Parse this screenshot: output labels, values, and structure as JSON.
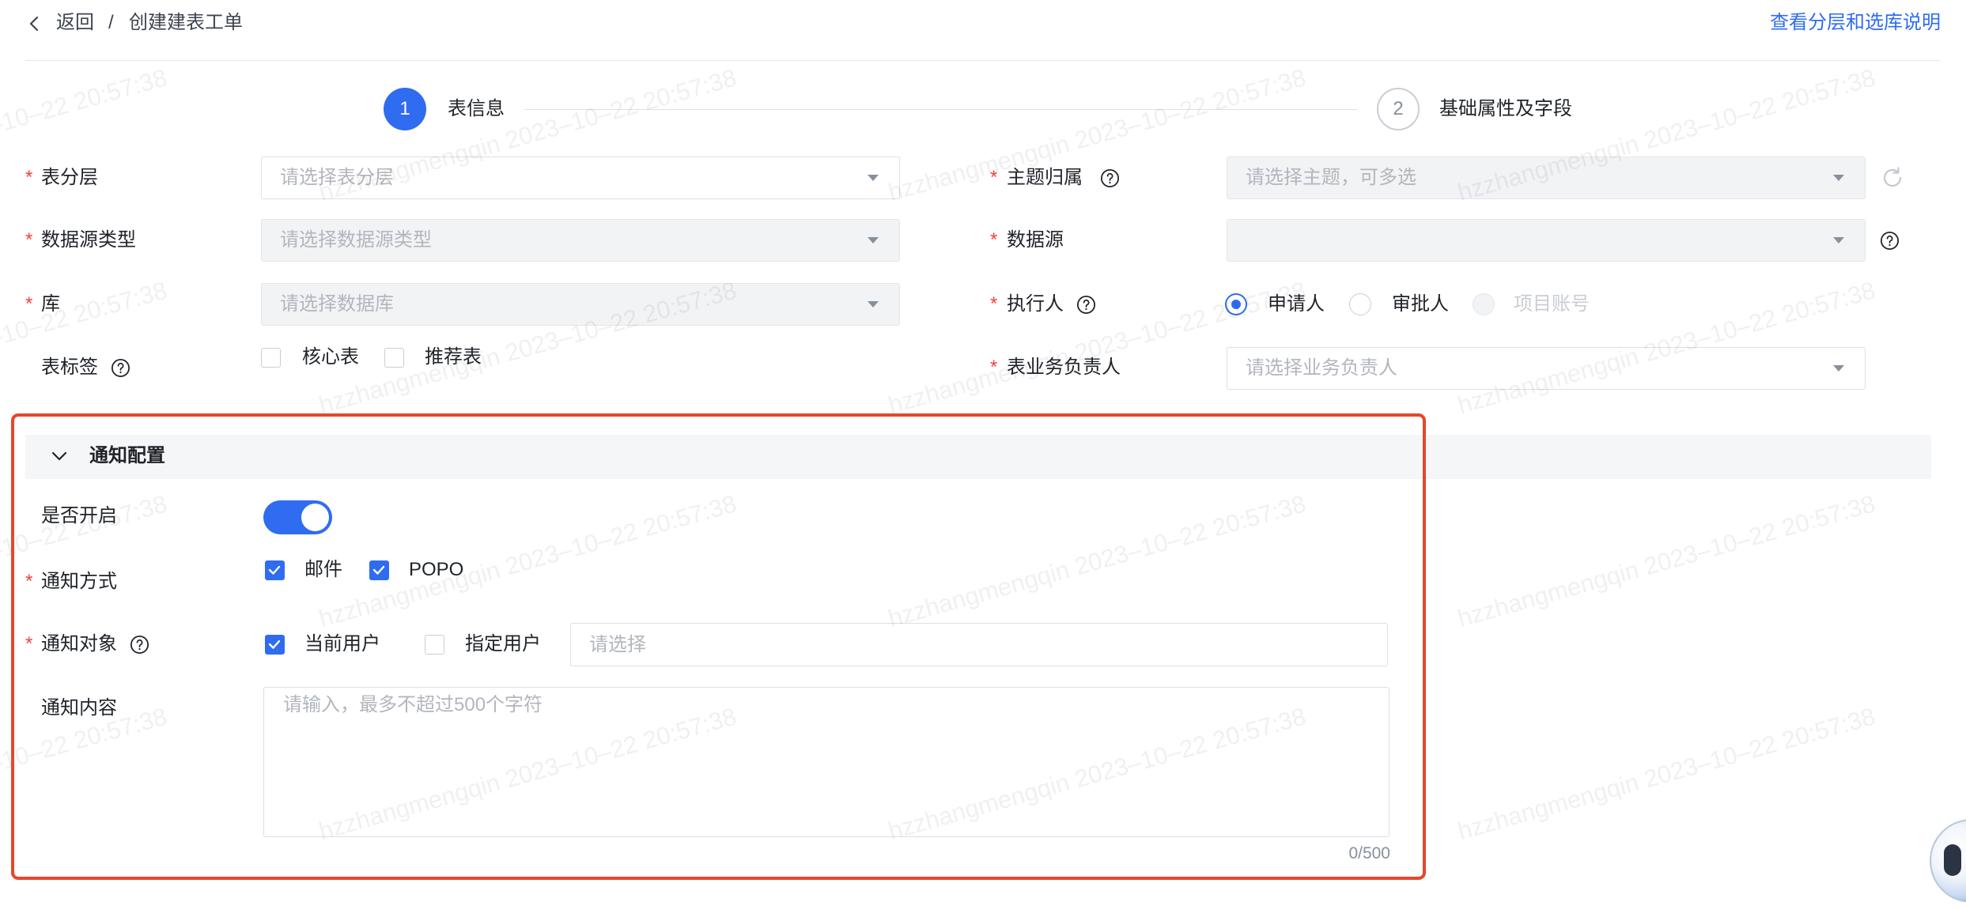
{
  "breadcrumb": {
    "back_label": "返回",
    "separator": "/",
    "current": "创建建表工单"
  },
  "header": {
    "help_link": "查看分层和选库说明"
  },
  "steps": [
    {
      "number": "1",
      "label": "表信息",
      "active": true
    },
    {
      "number": "2",
      "label": "基础属性及字段",
      "active": false
    }
  ],
  "required_mark": "*",
  "form": {
    "table_layer": {
      "label": "表分层",
      "required": true,
      "placeholder": "请选择表分层",
      "disabled": false
    },
    "datasource_type": {
      "label": "数据源类型",
      "required": true,
      "placeholder": "请选择数据源类型",
      "disabled": true
    },
    "database": {
      "label": "库",
      "required": true,
      "placeholder": "请选择数据库",
      "disabled": true
    },
    "table_tags": {
      "label": "表标签",
      "required": false,
      "options": [
        {
          "label": "核心表",
          "checked": false
        },
        {
          "label": "推荐表",
          "checked": false
        }
      ]
    },
    "subject": {
      "label": "主题归属",
      "required": true,
      "placeholder": "请选择主题，可多选",
      "disabled": true
    },
    "datasource": {
      "label": "数据源",
      "required": true,
      "disabled": true
    },
    "executor": {
      "label": "执行人",
      "required": true,
      "options": [
        {
          "label": "申请人",
          "selected": true,
          "disabled": false
        },
        {
          "label": "审批人",
          "selected": false,
          "disabled": false
        },
        {
          "label": "项目账号",
          "selected": false,
          "disabled": true
        }
      ]
    },
    "business_owner": {
      "label": "表业务负责人",
      "required": true,
      "placeholder": "请选择业务负责人",
      "disabled": false
    }
  },
  "notification": {
    "title": "通知配置",
    "expanded": true,
    "enabled": {
      "label": "是否开启",
      "value": true
    },
    "method": {
      "label": "通知方式",
      "required": true,
      "options": [
        {
          "label": "邮件",
          "checked": true
        },
        {
          "label": "POPO",
          "checked": true
        }
      ]
    },
    "target": {
      "label": "通知对象",
      "required": true,
      "options": [
        {
          "label": "当前用户",
          "checked": true
        },
        {
          "label": "指定用户",
          "checked": false
        }
      ],
      "placeholder": "请选择"
    },
    "content": {
      "label": "通知内容",
      "placeholder": "请输入，最多不超过500个字符",
      "counter": "0/500"
    }
  },
  "watermark": "hzzhangmengqin 2023–10–22 20:57:38",
  "icons": {
    "back": "chevron-left-icon",
    "help": "question-circle-icon",
    "refresh": "refresh-icon",
    "select_caret": "caret-down-icon",
    "collapse": "chevron-down-icon",
    "check": "checkmark-icon",
    "assistant": "assistant-avatar"
  },
  "colors": {
    "primary": "#2f6cf0",
    "required": "#f53f3f",
    "highlight_border": "#e5472c",
    "section_header_bg": "#f5f6f7"
  }
}
